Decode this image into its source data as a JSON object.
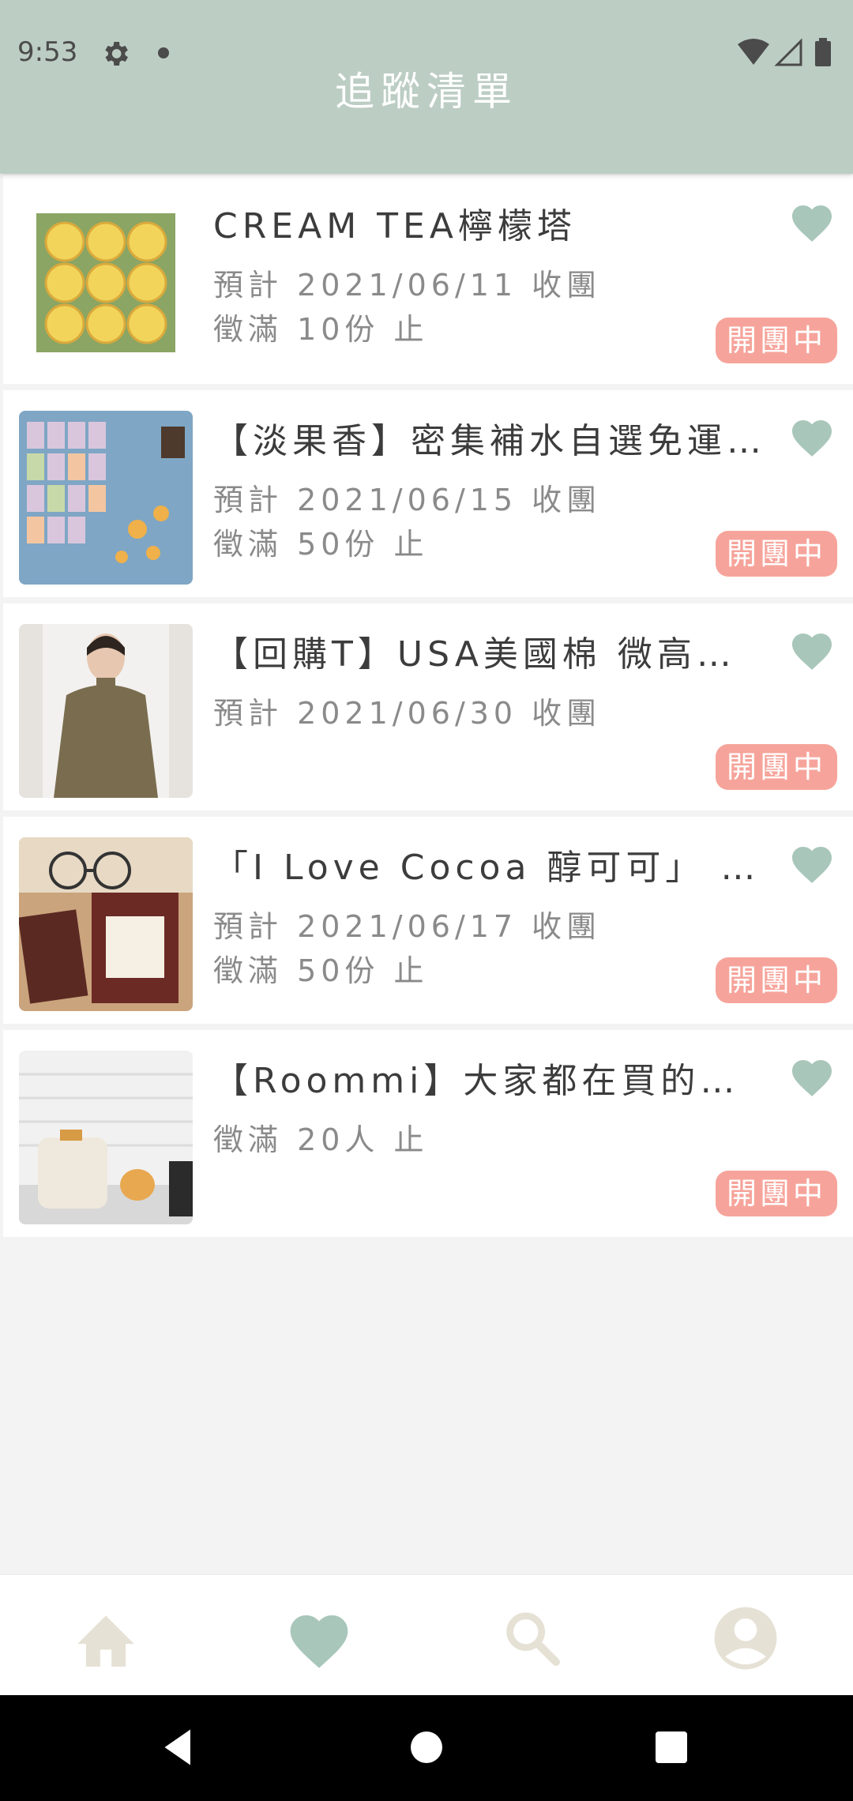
{
  "status_bar": {
    "time": "9:53"
  },
  "header": {
    "title": "追蹤清單"
  },
  "colors": {
    "header_bg": "#bccdc4",
    "heart": "#a9c6bb",
    "badge": "#f6a49b",
    "nav_inactive": "#e6e1d5",
    "nav_active": "#a9c6bb"
  },
  "items": [
    {
      "title": "CREAM TEA檸檬塔",
      "line1": "預計 2021/06/11 收團",
      "line2": "徵滿 10份 止",
      "badge": "開團中"
    },
    {
      "title": "【淡果香】密集補水自選免運...",
      "line1": "預計 2021/06/15 收團",
      "line2": "徵滿 50份 止",
      "badge": "開團中"
    },
    {
      "title": "【回購T】USA美國棉 微高領...",
      "line1": "預計 2021/06/30 收團",
      "line2": "",
      "badge": "開團中"
    },
    {
      "title": "「I Love Cocoa 醇可可」 (...",
      "line1": "預計 2021/06/17 收團",
      "line2": "徵滿 50份 止",
      "badge": "開團中"
    },
    {
      "title": "【Roommi】大家都在買的熱...",
      "line1": "徵滿 20人 止",
      "line2": "",
      "badge": "開團中"
    }
  ],
  "bottom_nav": [
    {
      "icon": "home-icon",
      "active": false
    },
    {
      "icon": "heart-icon",
      "active": true
    },
    {
      "icon": "search-icon",
      "active": false
    },
    {
      "icon": "account-icon",
      "active": false
    }
  ]
}
